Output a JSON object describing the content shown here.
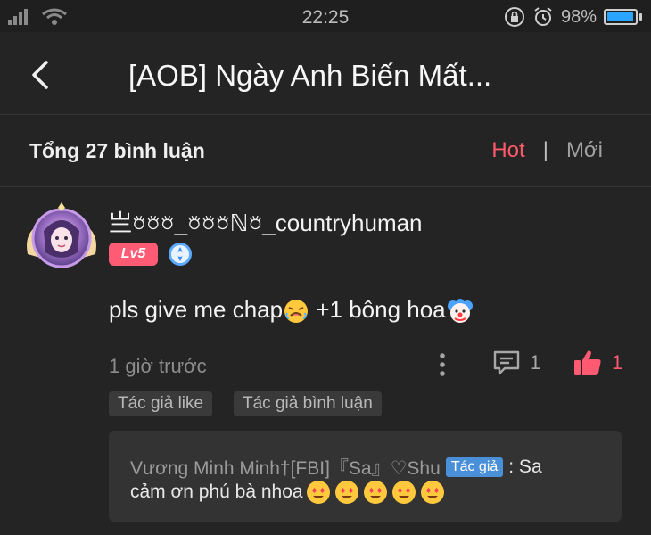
{
  "status_bar": {
    "time": "22:25",
    "battery_percent": "98%",
    "battery_level": 0.98
  },
  "header": {
    "title": "[AOB] Ngày Anh Biến Mất..."
  },
  "summary": {
    "total_comments": "Tổng 27 bình luận",
    "sort_hot": "Hot",
    "sort_separator": "|",
    "sort_new": "Mới"
  },
  "comment": {
    "username": "亗𖠶𖠶𖠶_𖠶𖠶𖠶ℕ𖠶_countryhuman",
    "level_badge": "Lv5",
    "text": "pls give me chap",
    "text_suffix": " +1 bông hoa",
    "time_ago": "1 giờ trước",
    "reply_count": "1",
    "like_count": "1",
    "tags": [
      "Tác giả like",
      "Tác giả bình luận"
    ],
    "reply": {
      "author": "Vương Minh Minh†[FBI]『Sa』♡Shu",
      "author_tag": "Tác giả",
      "colon_text": ": Sa",
      "text": "cảm ơn phú bà nhoa"
    }
  },
  "colors": {
    "background": "#242424",
    "accent_hot": "#ff5a6a",
    "level_badge": "#ff5b74",
    "like_pink": "#ff5a72",
    "author_tag_blue": "#4a90d9"
  }
}
